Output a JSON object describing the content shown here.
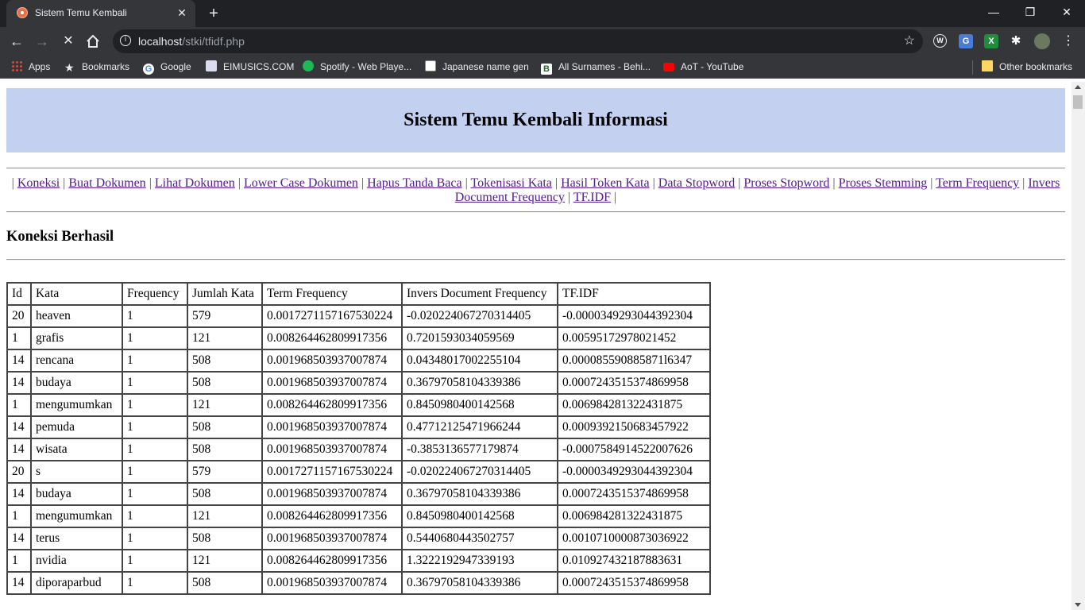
{
  "browser": {
    "tab_title": "Sistem Temu Kembali",
    "url_host": "localhost",
    "url_path": "/stki/tfidf.php",
    "bookmarks": [
      {
        "label": "Apps",
        "icon": "apps-grid-icon"
      },
      {
        "label": "Bookmarks",
        "icon": "star-icon"
      },
      {
        "label": "Google",
        "icon": "google-icon"
      },
      {
        "label": "EIMUSICS.COM",
        "icon": "eimusics-icon"
      },
      {
        "label": "Spotify - Web Playe...",
        "icon": "spotify-icon"
      },
      {
        "label": "Japanese name gen",
        "icon": "japanese-name-icon"
      },
      {
        "label": "All Surnames - Behi...",
        "icon": "surnames-icon"
      },
      {
        "label": "AoT - YouTube",
        "icon": "youtube-icon"
      }
    ],
    "other_bookmarks": "Other bookmarks"
  },
  "page": {
    "heading": "Sistem Temu Kembali Informasi",
    "nav_links": [
      "Koneksi",
      "Buat Dokumen",
      "Lihat Dokumen",
      "Lower Case Dokumen",
      "Hapus Tanda Baca",
      "Tokenisasi Kata",
      "Hasil Token Kata",
      "Data Stopword",
      "Proses Stopword",
      "Proses Stemming",
      "Term Frequency",
      "Invers Document Frequency",
      "TF.IDF"
    ],
    "status": "Koneksi Berhasil",
    "table": {
      "headers": [
        "Id",
        "Kata",
        "Frequency",
        "Jumlah Kata",
        "Term Frequency",
        "Invers Document Frequency",
        "TF.IDF"
      ],
      "rows": [
        [
          "20",
          "heaven",
          "1",
          "579",
          "0.0017271157167530224",
          "-0.020224067270314405",
          "-0.0000349293044392304"
        ],
        [
          "1",
          "grafis",
          "1",
          "121",
          "0.008264462809917356",
          "0.7201593034059569",
          "0.00595172978021452"
        ],
        [
          "14",
          "rencana",
          "1",
          "508",
          "0.001968503937007874",
          "0.04348017002255104",
          "0.000085590885871l6347"
        ],
        [
          "14",
          "budaya",
          "1",
          "508",
          "0.001968503937007874",
          "0.36797058104339386",
          "0.0007243515374869958"
        ],
        [
          "1",
          "mengumumkan",
          "1",
          "121",
          "0.008264462809917356",
          "0.8450980400142568",
          "0.006984281322431875"
        ],
        [
          "14",
          "pemuda",
          "1",
          "508",
          "0.001968503937007874",
          "0.47712125471966244",
          "0.0009392150683457922"
        ],
        [
          "14",
          "wisata",
          "1",
          "508",
          "0.001968503937007874",
          "-0.3853136577179874",
          "-0.0007584914522007626"
        ],
        [
          "20",
          "s",
          "1",
          "579",
          "0.0017271157167530224",
          "-0.020224067270314405",
          "-0.0000349293044392304"
        ],
        [
          "14",
          "budaya",
          "1",
          "508",
          "0.001968503937007874",
          "0.36797058104339386",
          "0.0007243515374869958"
        ],
        [
          "1",
          "mengumumkan",
          "1",
          "121",
          "0.008264462809917356",
          "0.8450980400142568",
          "0.006984281322431875"
        ],
        [
          "14",
          "terus",
          "1",
          "508",
          "0.001968503937007874",
          "0.5440680443502757",
          "0.0010710000873036922"
        ],
        [
          "1",
          "nvidia",
          "1",
          "121",
          "0.008264462809917356",
          "1.3222192947339193",
          "0.010927432187883631"
        ],
        [
          "14",
          "diporaparbud",
          "1",
          "508",
          "0.001968503937007874",
          "0.36797058104339386",
          "0.0007243515374869958"
        ]
      ]
    }
  }
}
